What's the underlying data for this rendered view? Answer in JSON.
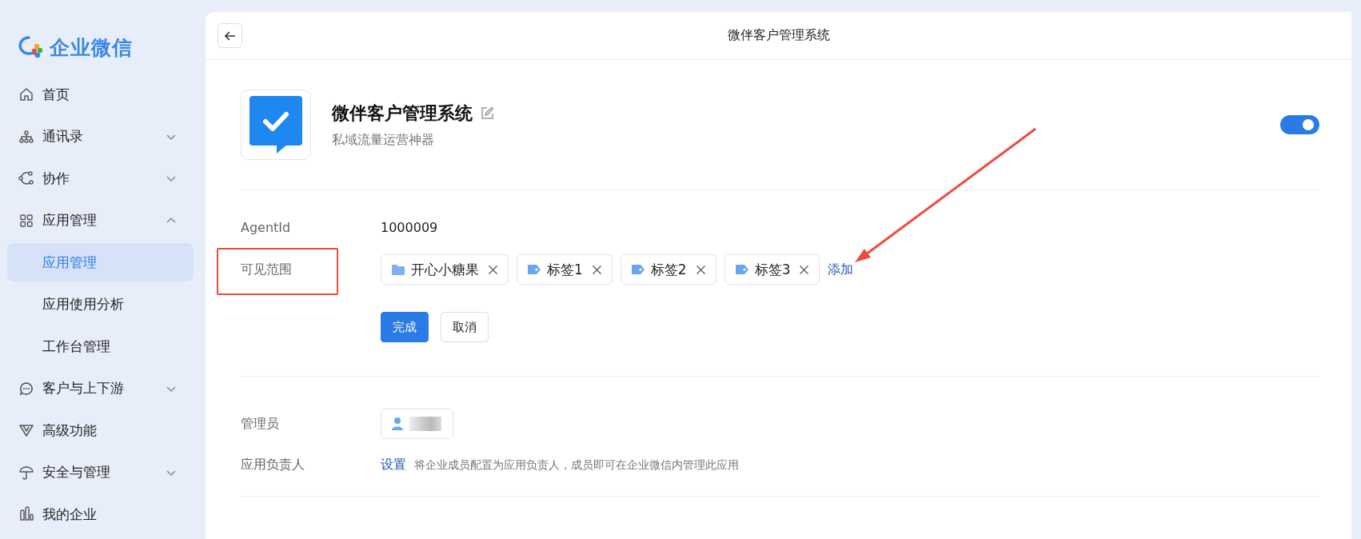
{
  "sidebar": {
    "logo_text": "企业微信",
    "items": [
      {
        "kind": "link",
        "label": "首页",
        "selected": false
      },
      {
        "kind": "group",
        "label": "通讯录",
        "expanded": false
      },
      {
        "kind": "group",
        "label": "协作",
        "expanded": false
      },
      {
        "kind": "group",
        "label": "应用管理",
        "expanded": true,
        "children": [
          {
            "label": "应用管理",
            "selected": true
          },
          {
            "label": "应用使用分析",
            "selected": false
          },
          {
            "label": "工作台管理",
            "selected": false
          }
        ]
      },
      {
        "kind": "group",
        "label": "客户与上下游",
        "expanded": false
      },
      {
        "kind": "link",
        "label": "高级功能",
        "selected": false
      },
      {
        "kind": "group",
        "label": "安全与管理",
        "expanded": false
      },
      {
        "kind": "link",
        "label": "我的企业",
        "selected": false
      }
    ]
  },
  "header": {
    "title": "微伴客户管理系统"
  },
  "app": {
    "name": "微伴客户管理系统",
    "subtitle": "私域流量运营神器",
    "enabled": true
  },
  "fields": {
    "agent_label": "AgentId",
    "agent_value": "1000009",
    "scope_label": "可见范围",
    "scope_items": [
      {
        "kind": "folder",
        "label": "开心小糖果"
      },
      {
        "kind": "tag",
        "label": "标签1"
      },
      {
        "kind": "tag",
        "label": "标签2"
      },
      {
        "kind": "tag",
        "label": "标签3"
      }
    ],
    "add_link": "添加",
    "confirm_button": "完成",
    "cancel_button": "取消",
    "admin_label": "管理员",
    "owner_label": "应用负责人",
    "owner_link": "设置",
    "owner_hint": "将企业成员配置为应用负责人，成员即可在企业微信内管理此应用"
  }
}
